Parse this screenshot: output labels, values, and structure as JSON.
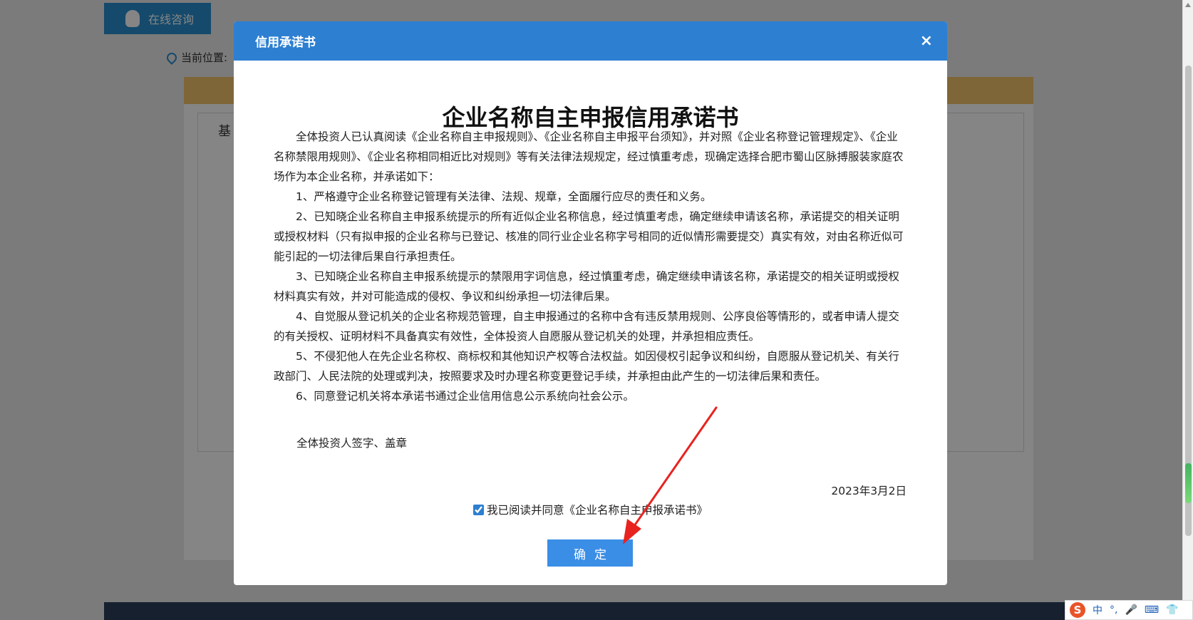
{
  "background": {
    "consult_button": "在线咨询",
    "location_label": "当前位置:",
    "card_title": "基"
  },
  "modal": {
    "title": "信用承诺书",
    "close_symbol": "×",
    "doc_title": "企业名称自主申报信用承诺书",
    "paragraphs": [
      "全体投资人已认真阅读《企业名称自主申报规则》、《企业名称自主申报平台须知》，并对照《企业名称登记管理规定》、《企业名称禁限用规则》、《企业名称相同相近比对规则》等有关法律法规规定，经过慎重考虑，现确定选择合肥市蜀山区脉搏服装家庭农场作为本企业名称，并承诺如下：",
      "1、严格遵守企业名称登记管理有关法律、法规、规章，全面履行应尽的责任和义务。",
      "2、已知晓企业名称自主申报系统提示的所有近似企业名称信息，经过慎重考虑，确定继续申请该名称，承诺提交的相关证明或授权材料（只有拟申报的企业名称与已登记、核准的同行业企业名称字号相同的近似情形需要提交）真实有效，对由名称近似可能引起的一切法律后果自行承担责任。",
      "3、已知晓企业名称自主申报系统提示的禁限用字词信息，经过慎重考虑，确定继续申请该名称，承诺提交的相关证明或授权材料真实有效，并对可能造成的侵权、争议和纠纷承担一切法律后果。",
      "4、自觉服从登记机关的企业名称规范管理，自主申报通过的名称中含有违反禁用规则、公序良俗等情形的，或者申请人提交的有关授权、证明材料不具备真实有效性，全体投资人自愿服从登记机关的处理，并承担相应责任。",
      "5、不侵犯他人在先企业名称权、商标权和其他知识产权等合法权益。如因侵权引起争议和纠纷，自愿服从登记机关、有关行政部门、人民法院的处理或判决，按照要求及时办理名称变更登记手续，并承担由此产生的一切法律后果和责任。",
      "6、同意登记机关将本承诺书通过企业信用信息公示系统向社会公示。"
    ],
    "signature": "全体投资人签字、盖章",
    "date": "2023年3月2日",
    "agree_label": "我已阅读并同意《企业名称自主申报承诺书》",
    "agree_checked": true,
    "confirm_label": "确定"
  },
  "ime": {
    "logo": "S",
    "mode": "中",
    "punct": "°,"
  },
  "colors": {
    "header_blue": "#2d7fd1",
    "button_blue": "#3a8ee6",
    "arrow_red": "#e8231f"
  }
}
